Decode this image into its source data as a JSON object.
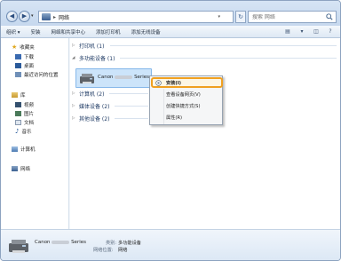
{
  "address": {
    "location": "网络"
  },
  "search": {
    "placeholder": "搜索 网络"
  },
  "toolbar": {
    "items": [
      "组织 ▾",
      "安装",
      "网络和共享中心",
      "添加打印机",
      "添加无线设备"
    ]
  },
  "sidebar": {
    "favorites": "收藏夹",
    "downloads": "下载",
    "desktop": "桌面",
    "recent": "最近访问的位置",
    "libraries": "库",
    "videos": "视频",
    "pictures": "图片",
    "documents": "文档",
    "music": "音乐",
    "computer": "计算机",
    "network": "网络"
  },
  "groups": {
    "printers": "打印机 (1)",
    "multifunction": "多功能设备 (1)",
    "computers": "计算机 (2)",
    "media": "媒体设备 (2)",
    "other": "其他设备 (2)"
  },
  "device": {
    "name_prefix": "Canon",
    "name_suffix": "Series"
  },
  "context_menu": {
    "install": "安装(I)",
    "view_page": "查看设备网页(V)",
    "create_shortcut": "创建快捷方式(S)",
    "properties": "属性(R)"
  },
  "details": {
    "name_prefix": "Canon",
    "name_suffix": "Series",
    "category_label": "类别:",
    "category_value": "多功能设备",
    "location_label": "网络位置:",
    "location_value": "网络"
  },
  "colors": {
    "highlight": "#f0a020",
    "selection": "#cce4fa"
  }
}
